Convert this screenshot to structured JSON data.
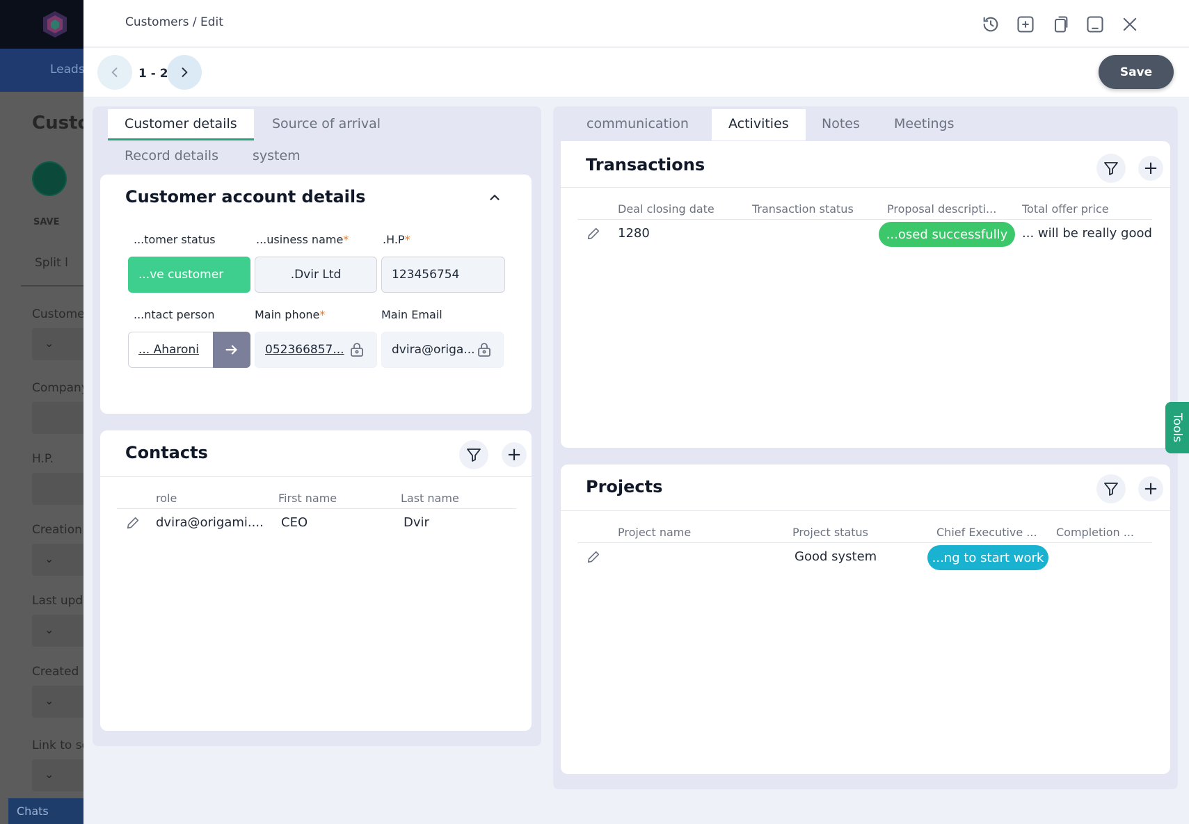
{
  "background": {
    "nav_label": "Leads",
    "title": "Custo",
    "save_label": "SAVE",
    "split_label": "Split l",
    "field_labels": [
      "Custome",
      "Company",
      "H.P.",
      "Creation",
      "Last upda",
      "Created b",
      "Link to so"
    ],
    "chats_label": "Chats"
  },
  "header": {
    "breadcrumb": "Customers / Edit",
    "icons": [
      "history-icon",
      "add-icon",
      "duplicate-icon",
      "minimize-icon",
      "close-icon"
    ]
  },
  "subbar": {
    "pager": "1 - 2",
    "save_label": "Save"
  },
  "left": {
    "tabs": [
      "Customer details",
      "Source of arrival",
      "Record details",
      "system"
    ],
    "account_card": {
      "title": "Customer account details",
      "fields": {
        "status_label": "...tomer status",
        "status_value": "...ve customer",
        "business_label": "...usiness name",
        "business_value": ".Dvir Ltd",
        "hp_label": ".H.P",
        "hp_value": "123456754",
        "contact_label": "...ntact person",
        "contact_value": "... Aharoni",
        "phone_label": "Main phone",
        "phone_value": "052366857...",
        "email_label": "Main Email",
        "email_value": "dvira@origa..."
      },
      "required_mark": "*"
    },
    "contacts_card": {
      "title": "Contacts",
      "columns": [
        "role",
        "First name",
        "Last name"
      ],
      "rows": [
        [
          "dvira@origami....",
          "CEO",
          "Dvir"
        ]
      ]
    }
  },
  "right": {
    "tabs": [
      "communication",
      "Activities",
      "Notes",
      "Meetings"
    ],
    "active_tab": "Activities",
    "transactions": {
      "title": "Transactions",
      "columns": [
        "Deal closing date",
        "Transaction status",
        "Proposal descripti...",
        "Total offer price"
      ],
      "row": {
        "closing": "1280",
        "status_pill": "...osed successfully",
        "price": "... will be really good"
      }
    },
    "projects": {
      "title": "Projects",
      "columns": [
        "Project name",
        "Project status",
        "Chief Executive ...",
        "Completion ..."
      ],
      "row": {
        "status": "Good system",
        "pill": "...ng to start work"
      }
    }
  },
  "tools_label": "Tools",
  "colors": {
    "accent_green": "#3ecf8e",
    "pill_green": "#3cc76a",
    "pill_cyan": "#19b3d1",
    "save_bg": "#4b5563"
  }
}
